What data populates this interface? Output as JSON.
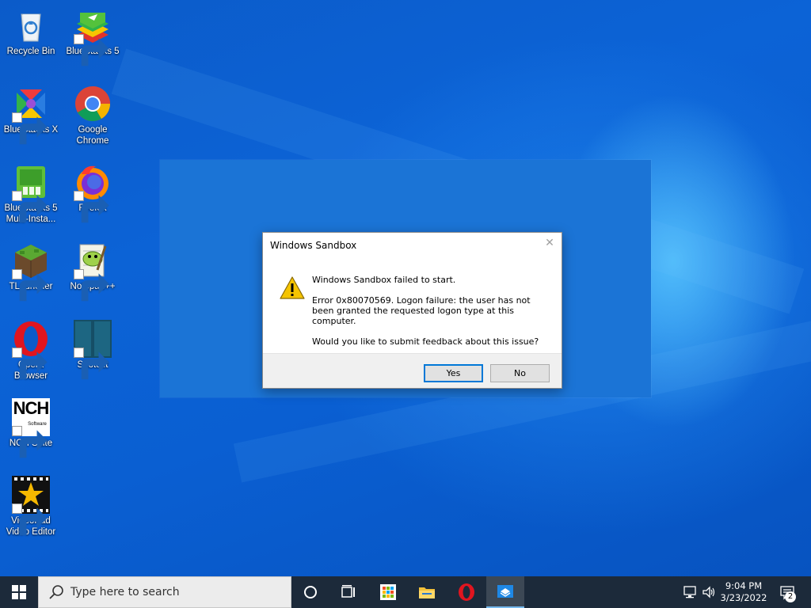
{
  "desktop": {
    "icons": [
      {
        "label": "Recycle Bin",
        "icon": "recycle-bin-icon"
      },
      {
        "label": "BlueStacks 5",
        "icon": "bluestacks5-icon"
      },
      {
        "label": "BlueStacks X",
        "icon": "bluestacksx-icon"
      },
      {
        "label": "Google Chrome",
        "icon": "chrome-icon"
      },
      {
        "label": "BlueStacks 5 Multi-Insta...",
        "icon": "bluestacks-multi-instance-icon"
      },
      {
        "label": "Firefox",
        "icon": "firefox-icon"
      },
      {
        "label": "TLauncher",
        "icon": "tlauncher-icon"
      },
      {
        "label": "Notepad++",
        "icon": "notepadpp-icon"
      },
      {
        "label": "Opera Browser",
        "icon": "opera-icon"
      },
      {
        "label": "Shotcut",
        "icon": "shotcut-icon"
      },
      {
        "label": "NCH Suite",
        "icon": "nch-suite-icon"
      },
      {
        "label": "VideoPad Video Editor",
        "icon": "videopad-icon"
      }
    ],
    "nch_logo_text": "NCH",
    "nch_logo_sub": "Software"
  },
  "dialog": {
    "title": "Windows Sandbox",
    "close_glyph": "✕",
    "message_heading": "Windows Sandbox failed to start.",
    "message_error": "Error 0x80070569. Logon failure: the user has not been granted the requested logon type at this computer.",
    "message_question": "Would you like to submit feedback about this issue?",
    "yes_label": "Yes",
    "no_label": "No",
    "icon": "warning-icon"
  },
  "taskbar": {
    "search_placeholder": "Type here to search",
    "pinned": [
      "cortana-icon",
      "task-view-icon",
      "store-icon",
      "file-explorer-icon",
      "opera-icon",
      "windows-sandbox-icon"
    ],
    "clock_time": "9:04 PM",
    "clock_date": "3/23/2022",
    "notification_count": "2"
  },
  "colors": {
    "desktop_blue": "#0a5fd0",
    "taskbar": "#1c2a3a",
    "accent": "#0078d7"
  }
}
